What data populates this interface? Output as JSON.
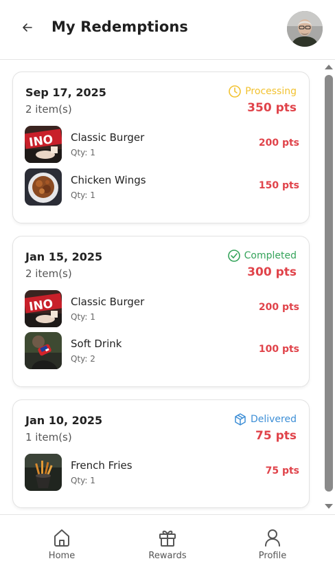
{
  "header": {
    "title": "My Redemptions"
  },
  "orders": [
    {
      "date": "Sep 17, 2025",
      "count": "2 item(s)",
      "status": "Processing",
      "status_color": "#f2c230",
      "status_icon": "clock-icon",
      "total": "350 pts",
      "items": [
        {
          "name": "Classic Burger",
          "qty": "Qty: 1",
          "pts": "200 pts"
        },
        {
          "name": "Chicken Wings",
          "qty": "Qty: 1",
          "pts": "150 pts"
        }
      ]
    },
    {
      "date": "Jan 15, 2025",
      "count": "2 item(s)",
      "status": "Completed",
      "status_color": "#34a35a",
      "status_icon": "check-circle-icon",
      "total": "300 pts",
      "items": [
        {
          "name": "Classic Burger",
          "qty": "Qty: 1",
          "pts": "200 pts"
        },
        {
          "name": "Soft Drink",
          "qty": "Qty: 2",
          "pts": "100 pts"
        }
      ]
    },
    {
      "date": "Jan 10, 2025",
      "count": "1 item(s)",
      "status": "Delivered",
      "status_color": "#3c8ed6",
      "status_icon": "package-icon",
      "total": "75 pts",
      "items": [
        {
          "name": "French Fries",
          "qty": "Qty: 1",
          "pts": "75 pts"
        }
      ]
    }
  ],
  "nav": [
    {
      "label": "Home",
      "icon": "home-icon"
    },
    {
      "label": "Rewards",
      "icon": "gift-icon"
    },
    {
      "label": "Profile",
      "icon": "user-icon"
    }
  ],
  "colors": {
    "points": "#e0434a",
    "processing": "#f2c230",
    "completed": "#34a35a",
    "delivered": "#3c8ed6"
  }
}
